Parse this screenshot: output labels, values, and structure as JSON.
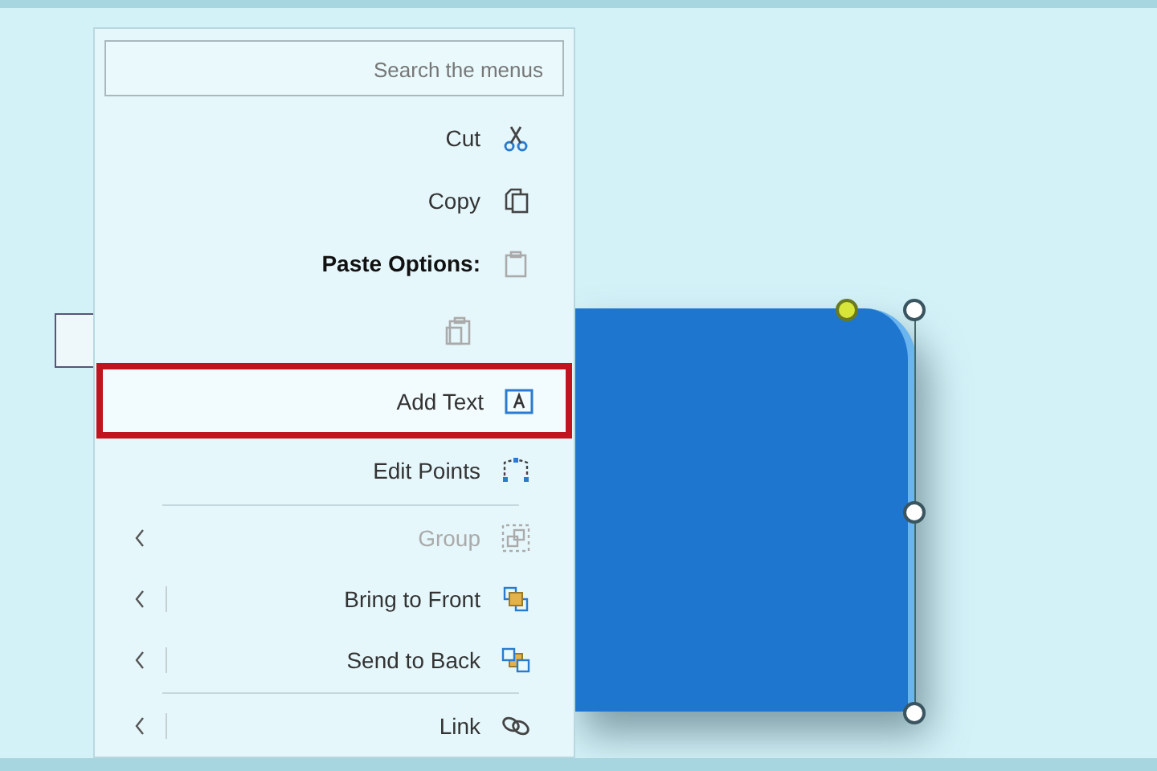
{
  "search": {
    "placeholder": "Search the menus"
  },
  "menu_items": [
    {
      "kind": "command",
      "label": "Cut",
      "disabled": false,
      "marked": false
    },
    {
      "kind": "command",
      "label": "Copy",
      "disabled": false,
      "marked": false
    },
    {
      "kind": "header",
      "label": "Paste Options:",
      "disabled": false,
      "marked": false
    },
    {
      "kind": "paste",
      "disabled": true,
      "marked": false
    },
    {
      "kind": "command",
      "label": "Add Text",
      "disabled": false,
      "marked": true
    },
    {
      "kind": "command",
      "label": "Edit Points",
      "disabled": false,
      "marked": false
    },
    {
      "kind": "separator"
    },
    {
      "kind": "submenu",
      "label": "Group",
      "disabled": true,
      "marked": false
    },
    {
      "kind": "split",
      "label": "Bring to Front",
      "disabled": false,
      "marked": false
    },
    {
      "kind": "split",
      "label": "Send to Back",
      "disabled": false,
      "marked": false
    },
    {
      "kind": "separator"
    },
    {
      "kind": "split",
      "label": "Link",
      "disabled": false,
      "marked": false
    }
  ]
}
